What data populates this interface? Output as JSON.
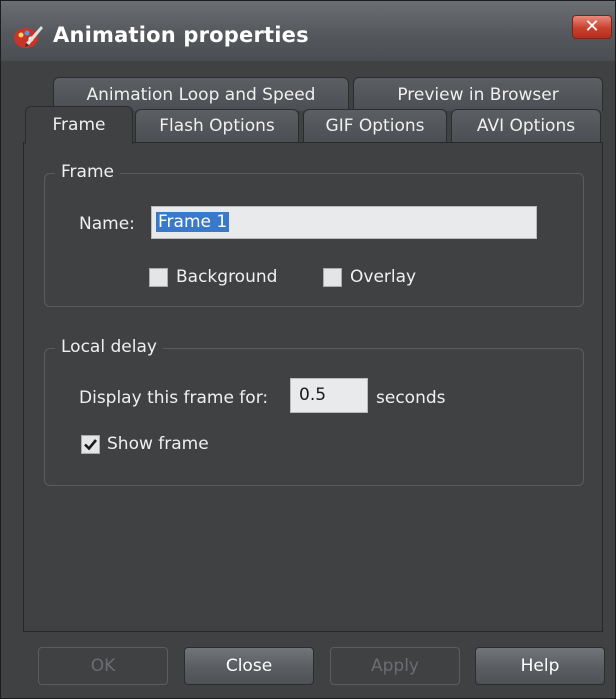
{
  "window": {
    "title": "Animation properties",
    "close_glyph": "✕"
  },
  "tabs": {
    "row1": [
      "Animation Loop and Speed",
      "Preview in Browser"
    ],
    "row2": [
      "Frame",
      "Flash Options",
      "GIF Options",
      "AVI Options"
    ],
    "active": "Frame"
  },
  "frame_group": {
    "legend": "Frame",
    "name_label": "Name:",
    "name_value": "Frame 1",
    "background_label": "Background",
    "background_checked": false,
    "overlay_label": "Overlay",
    "overlay_checked": false
  },
  "delay_group": {
    "legend": "Local delay",
    "display_label": "Display this frame for:",
    "delay_value": "0.5",
    "seconds_label": "seconds",
    "show_frame_label": "Show frame",
    "show_frame_checked": true
  },
  "buttons": {
    "ok": "OK",
    "close": "Close",
    "apply": "Apply",
    "help": "Help"
  },
  "icons": {
    "app": "paint-palette-icon",
    "close": "close-icon",
    "check": "checkmark-icon"
  },
  "colors": {
    "selection": "#3a79c9",
    "close_button": "#c8412f"
  }
}
